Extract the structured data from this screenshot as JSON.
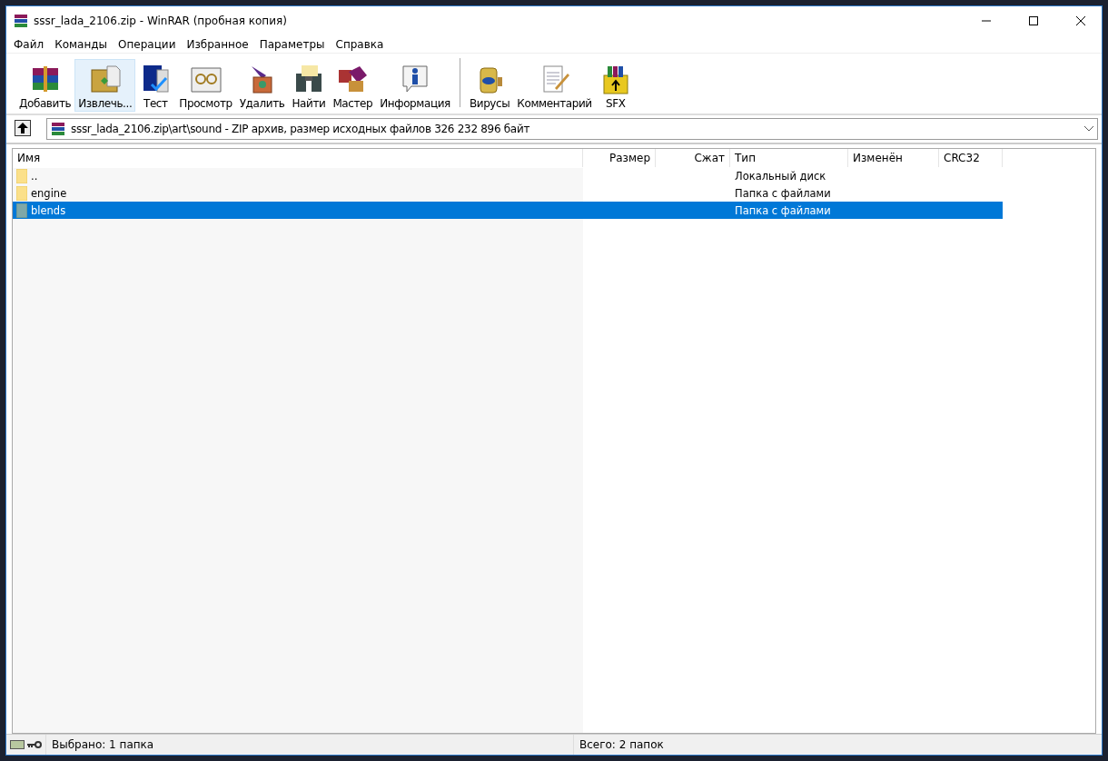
{
  "window": {
    "title": "sssr_lada_2106.zip - WinRAR (пробная копия)"
  },
  "menu": [
    "Файл",
    "Команды",
    "Операции",
    "Избранное",
    "Параметры",
    "Справка"
  ],
  "toolbar": [
    {
      "kind": "add",
      "label": "Добавить",
      "hovered": false
    },
    {
      "kind": "extract",
      "label": "Извлечь...",
      "hovered": true
    },
    {
      "kind": "test",
      "label": "Тест",
      "hovered": false
    },
    {
      "kind": "view",
      "label": "Просмотр",
      "hovered": false
    },
    {
      "kind": "delete",
      "label": "Удалить",
      "hovered": false
    },
    {
      "kind": "find",
      "label": "Найти",
      "hovered": false
    },
    {
      "kind": "wizard",
      "label": "Мастер",
      "hovered": false
    },
    {
      "kind": "info",
      "label": "Информация",
      "hovered": false
    },
    {
      "kind": "separator"
    },
    {
      "kind": "virus",
      "label": "Вирусы",
      "hovered": false
    },
    {
      "kind": "comment",
      "label": "Комментарий",
      "hovered": false
    },
    {
      "kind": "sfx",
      "label": "SFX",
      "hovered": false
    }
  ],
  "address": {
    "path": "sssr_lada_2106.zip\\art\\sound - ZIP архив, размер исходных файлов 326 232 896 байт"
  },
  "table": {
    "columns": [
      "Имя",
      "Размер",
      "Сжат",
      "Тип",
      "Изменён",
      "CRC32"
    ],
    "rows": [
      {
        "name": "..",
        "type": "Локальный диск",
        "selected": false
      },
      {
        "name": "engine",
        "type": "Папка с файлами",
        "selected": false
      },
      {
        "name": "blends",
        "type": "Папка с файлами",
        "selected": true
      }
    ]
  },
  "status_bar": {
    "left": "Выбрано: 1 папка",
    "right": "Всего: 2 папок"
  }
}
